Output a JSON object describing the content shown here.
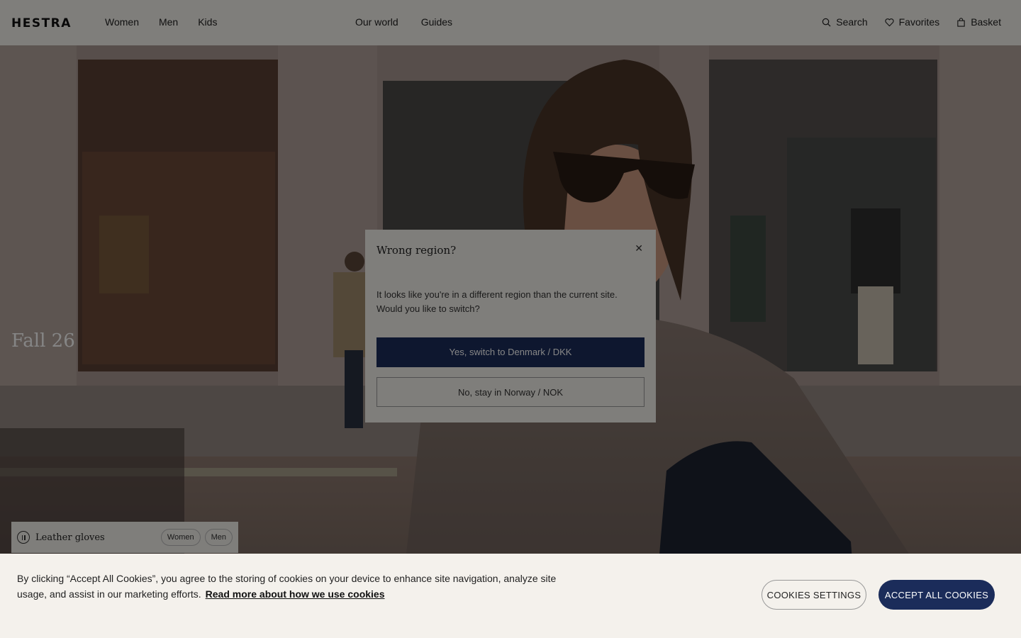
{
  "header": {
    "logo": "HESTRA",
    "nav_left": [
      "Women",
      "Men",
      "Kids"
    ],
    "nav_center": [
      "Our world",
      "Guides"
    ],
    "search_label": "Search",
    "favorites_label": "Favorites",
    "basket_label": "Basket"
  },
  "hero": {
    "title": "Fall 26",
    "category": {
      "label": "Leather gloves",
      "chips": [
        "Women",
        "Men"
      ]
    }
  },
  "region_modal": {
    "title": "Wrong region?",
    "body_line1": "It looks like you're in a different region than the current site.",
    "body_line2": "Would you like to switch?",
    "primary_label": "Yes, switch to Denmark / DKK",
    "secondary_label": "No, stay in Norway / NOK",
    "close_glyph": "✕"
  },
  "cookie_banner": {
    "text": "By clicking “Accept All Cookies”, you agree to the storing of cookies on your device to enhance site navigation, analyze site usage, and assist in our marketing efforts.",
    "link_label": "Read more about how we use cookies",
    "settings_label": "COOKIES SETTINGS",
    "accept_label": "ACCEPT ALL COOKIES"
  },
  "colors": {
    "accent_navy": "#1b2c5a",
    "banner_bg": "#f4f1ec"
  },
  "icons": [
    "search-icon",
    "heart-icon",
    "bag-icon",
    "pause-icon",
    "close-icon"
  ]
}
